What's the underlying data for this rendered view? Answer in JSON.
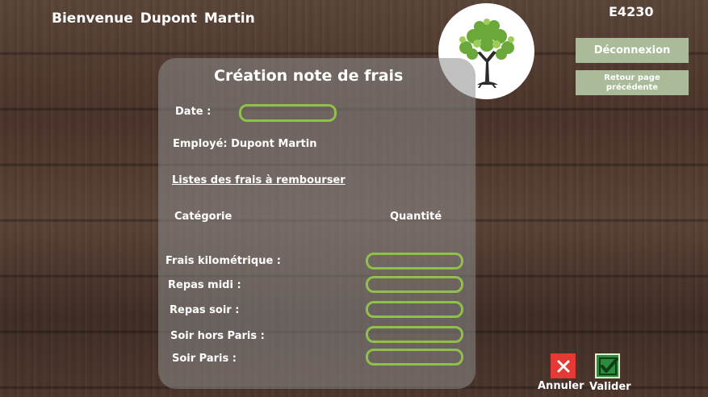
{
  "header": {
    "welcome": "Bienvenue  Dupont  Martin",
    "user_code": "E4230"
  },
  "nav": {
    "logout_label": "Déconnexion",
    "back_label_line1": "Retour page",
    "back_label_line2": "précédente"
  },
  "form": {
    "title": "Création note de frais",
    "date_label": "Date :",
    "date_value": "",
    "employee_label": "Employé: Dupont Martin",
    "expenses_link": "Listes des frais à rembourser",
    "col_category": "Catégorie",
    "col_quantity": "Quantité",
    "rows": [
      {
        "label": "Frais kilométrique :",
        "value": ""
      },
      {
        "label": "Repas midi :",
        "value": ""
      },
      {
        "label": "Repas soir :",
        "value": ""
      },
      {
        "label": "Soir hors Paris :",
        "value": ""
      },
      {
        "label": "Soir Paris :",
        "value": ""
      }
    ]
  },
  "actions": {
    "cancel_label": "Annuler",
    "validate_label": "Valider"
  },
  "icons": {
    "logo": "tree-logo-icon",
    "cancel": "close-icon",
    "validate": "checkmark-icon"
  },
  "colors": {
    "field_border": "#8fc04a",
    "button_bg": "#a9bb98",
    "cancel": "#e53935",
    "validate": "#2e8b3e"
  }
}
